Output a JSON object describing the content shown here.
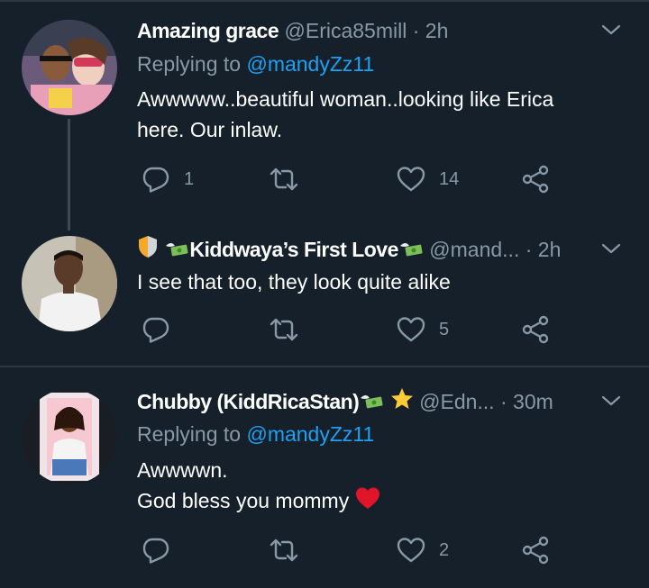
{
  "tweets": [
    {
      "name": "Amazing grace",
      "handle": "@Erica85mill",
      "separator": "·",
      "time": "2h",
      "replying_prefix": "Replying to",
      "replying_to": "@mandyZz11",
      "text_lines": [
        "Awwwww..beautiful woman..looking like Erica",
        "here. Our inlaw."
      ],
      "reply_count": "1",
      "retweet_count": "",
      "like_count": "14"
    },
    {
      "name": "Kiddwaya’s First Love",
      "handle": "@mand...",
      "separator": "·",
      "time": "2h",
      "text": "I see that too, they look quite alike",
      "reply_count": "",
      "retweet_count": "",
      "like_count": "5"
    },
    {
      "name": "Chubby (KiddRicaStan)",
      "handle": "@Edn...",
      "separator": "·",
      "time": "30m",
      "replying_prefix": "Replying to",
      "replying_to": "@mandyZz11",
      "text_lines": [
        "Awwwwn.",
        "God bless you mommy"
      ],
      "reply_count": "",
      "retweet_count": "",
      "like_count": "2"
    }
  ],
  "icons": {
    "reply": "reply-icon",
    "retweet": "retweet-icon",
    "like": "heart-icon",
    "share": "share-icon",
    "more": "chevron-down-icon"
  },
  "colors": {
    "background": "#15202b",
    "muted": "#8899a6",
    "link": "#1da1f2",
    "divider": "#2b3640"
  }
}
